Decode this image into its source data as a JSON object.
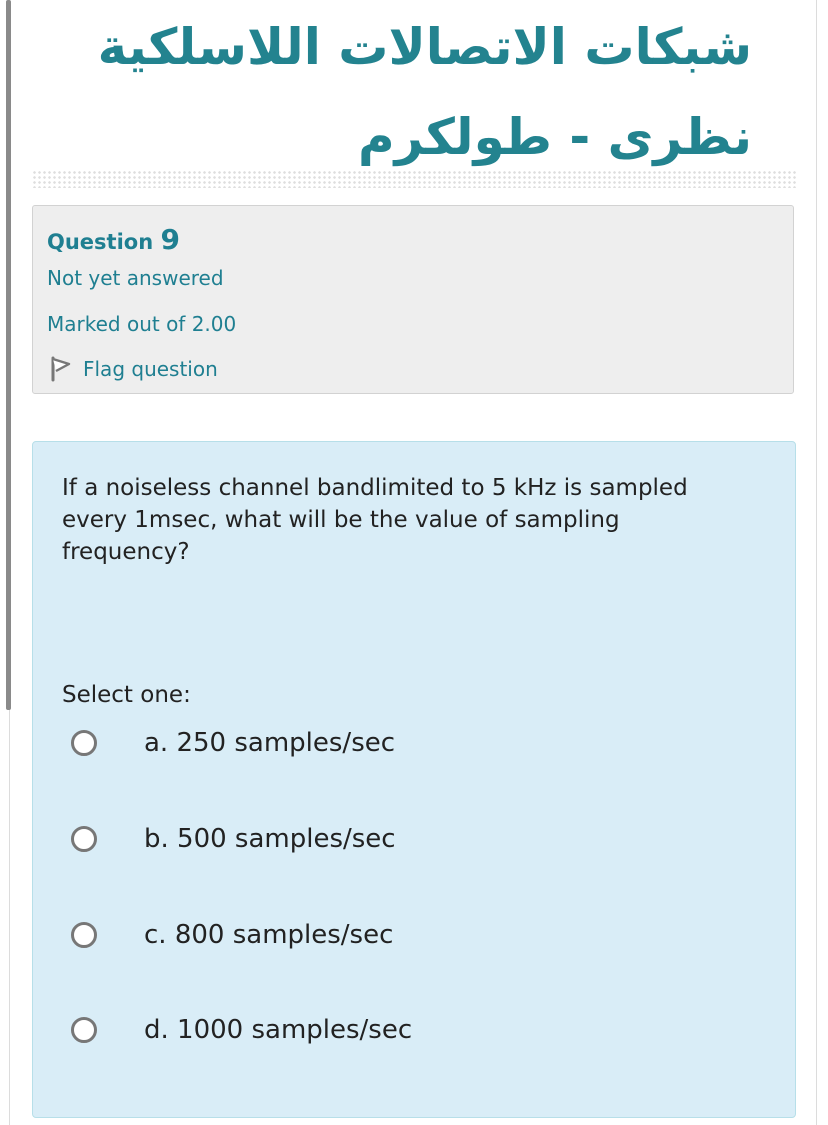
{
  "course": {
    "title_line1": "شبكات الاتصالات اللاسلكية",
    "title_line2": "نظرى - طولكرم"
  },
  "question_info": {
    "label": "Question",
    "number": "9",
    "state": "Not yet answered",
    "grade": "Marked out of 2.00",
    "flag_label": "Flag question",
    "flag_icon": "flag-outline-icon"
  },
  "question": {
    "text": "If a noiseless channel bandlimited to 5 kHz is sampled every 1msec, what will be the value of sampling frequency?",
    "select_prompt": "Select one:",
    "options": [
      {
        "label": "a. 250 samples/sec",
        "selected": false
      },
      {
        "label": "b. 500 samples/sec",
        "selected": false
      },
      {
        "label": "c. 800 samples/sec",
        "selected": false
      },
      {
        "label": "d. 1000 samples/sec",
        "selected": false
      }
    ]
  },
  "colors": {
    "accent_teal": "#23838f",
    "info_text": "#1f7f91",
    "question_background": "#d9edf7",
    "info_background": "#eeeeee",
    "radio_border": "#777777"
  }
}
